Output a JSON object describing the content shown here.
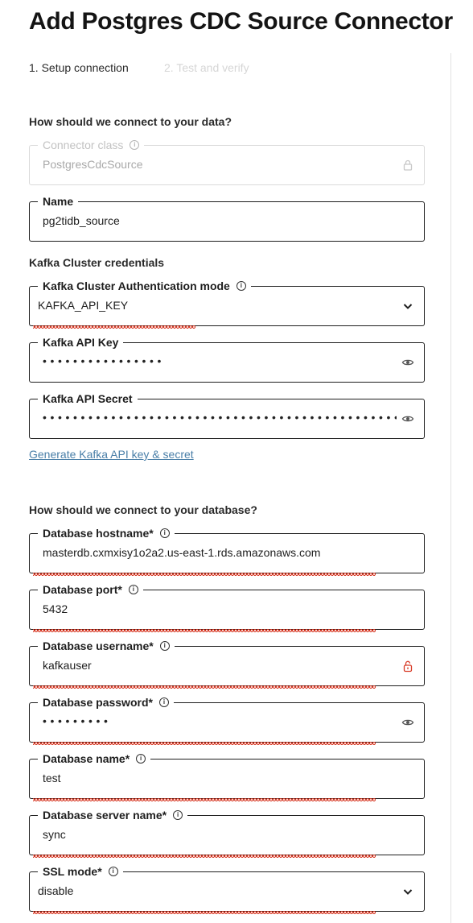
{
  "page": {
    "title": "Add Postgres CDC Source Connector",
    "steps": [
      "1. Setup connection",
      "2. Test and verify"
    ]
  },
  "sections": {
    "data_heading": "How should we connect to your data?",
    "kafka_heading": "Kafka Cluster credentials",
    "db_heading": "How should we connect to your database?"
  },
  "fields": {
    "connector_class": {
      "label": "Connector class",
      "value": "PostgresCdcSource",
      "disabled": true,
      "icon": "lock-icon"
    },
    "name": {
      "label": "Name",
      "value": "pg2tidb_source"
    },
    "auth_mode": {
      "label": "Kafka Cluster Authentication mode",
      "value": "KAFKA_API_KEY",
      "icon": "chevron-down-icon"
    },
    "api_key": {
      "label": "Kafka API Key",
      "masked": "••••••••••••••••",
      "icon": "eye-icon"
    },
    "api_secret": {
      "label": "Kafka API Secret",
      "masked": "••••••••••••••••••••••••••••••••••••••••••••••••",
      "icon": "eye-icon"
    },
    "db_hostname": {
      "label": "Database hostname*",
      "value": "masterdb.cxmxisy1o2a2.us-east-1.rds.amazonaws.com"
    },
    "db_port": {
      "label": "Database port*",
      "value": "5432"
    },
    "db_username": {
      "label": "Database username*",
      "value": "kafkauser",
      "icon": "unlocked-warning-icon"
    },
    "db_password": {
      "label": "Database password*",
      "masked": "•••••••••",
      "icon": "eye-icon"
    },
    "db_name": {
      "label": "Database name*",
      "value": "test"
    },
    "db_server_name": {
      "label": "Database server name*",
      "value": "sync"
    },
    "ssl_mode": {
      "label": "SSL mode*",
      "value": "disable",
      "icon": "chevron-down-icon"
    }
  },
  "links": {
    "generate": "Generate Kafka API key & secret"
  },
  "colors": {
    "border": "#1e1e1e",
    "disabled": "#c2c2c2",
    "link": "#4a7fa8",
    "spellcheck": "#d83a26",
    "warning": "#d83a26"
  }
}
